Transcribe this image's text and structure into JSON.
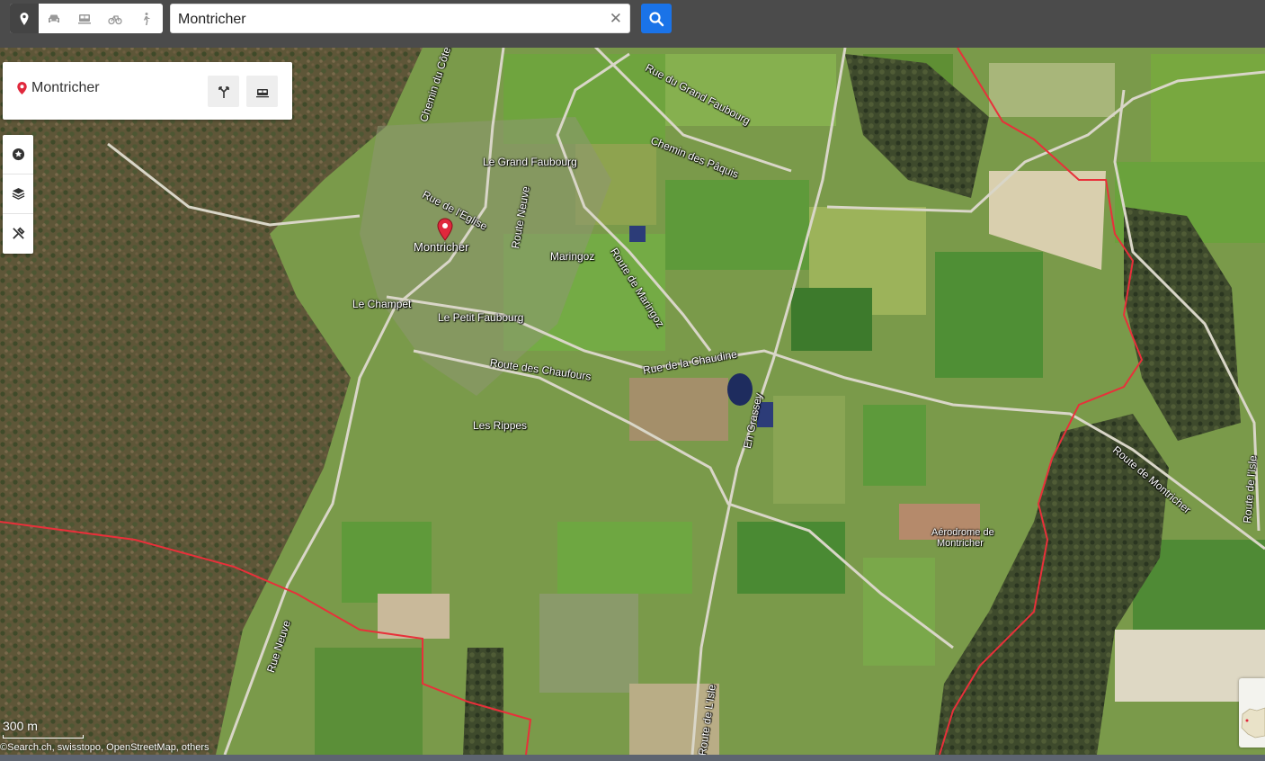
{
  "search": {
    "value": "Montricher"
  },
  "modes": [
    "location-icon",
    "car-icon",
    "train-icon",
    "bike-icon",
    "walk-icon"
  ],
  "info_card": {
    "title": "Montricher"
  },
  "map_labels": {
    "chemin_du_cotea": "Chemin du Côtea",
    "rue_du_grand_faubourg": "Rue du Grand Faubourg",
    "chemin_des_paquis": "Chemin des Pâquis",
    "le_grand_faubourg": "Le Grand Faubourg",
    "rue_de_leglise": "Rue de l'Eglise",
    "route_neuve": "Route Neuve",
    "montricher": "Montricher",
    "maringoz": "Maringoz",
    "route_de_maringoz": "Route de Maringoz",
    "le_champet": "Le Champet",
    "le_petit_faubourg": "Le Petit Faubourg",
    "rue_de_la_chaudine": "Rue de la Chaudine",
    "route_des_chaufours": "Route des Chaufours",
    "en_grassey": "En Grassey",
    "les_rippes": "Les Rippes",
    "route_de_montricher": "Route de Montricher",
    "route_de_lisle_right": "Route de l'Isle",
    "aerodrome": "Aérodrome de",
    "aerodrome_2": "Montricher",
    "rue_neuve": "Rue Neuve",
    "route_de_lisle_bottom": "Route de L'Isle"
  },
  "scale": "300 m",
  "attribution": "©Search.ch, swisstopo, OpenStreetMap, others",
  "colors": {
    "accent": "#1a73e8",
    "marker": "#e0283c",
    "border": "#e8303a"
  }
}
